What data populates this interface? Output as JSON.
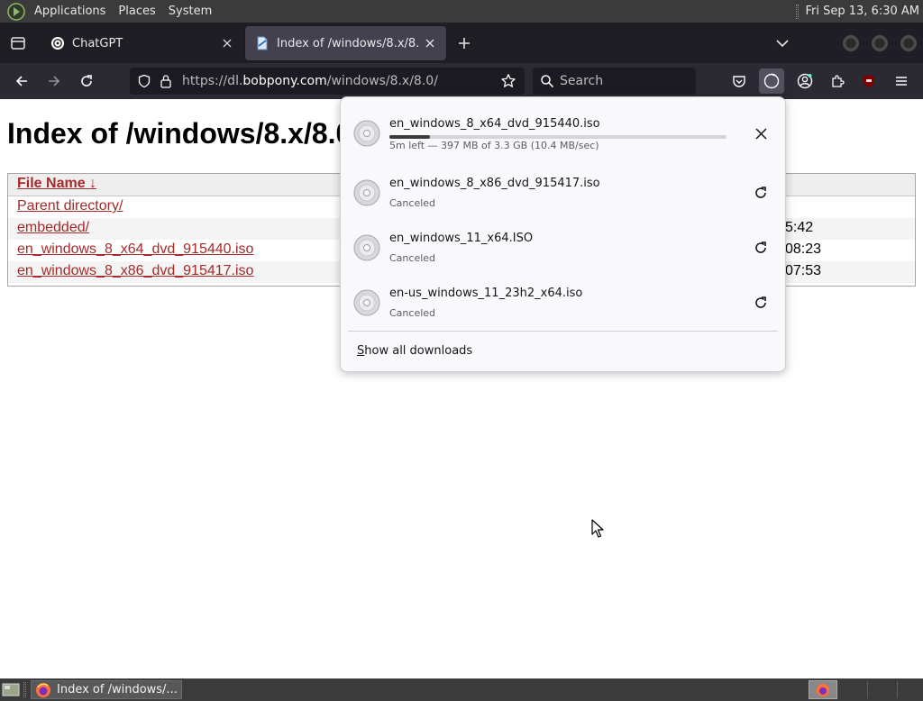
{
  "top_panel": {
    "menus": [
      "Applications",
      "Places",
      "System"
    ],
    "clock": "Fri Sep 13,  6:30 AM"
  },
  "browser": {
    "tabs": [
      {
        "title": "ChatGPT",
        "favicon": "chatgpt-favicon-icon",
        "active": false
      },
      {
        "title": "Index of /windows/8.x/8.0/",
        "favicon": "document-favicon-icon",
        "active": true
      }
    ],
    "url": {
      "prefix": "https://dl.",
      "host": "bobpony.com",
      "path": "/windows/8.x/8.0/"
    },
    "search_placeholder": "Search"
  },
  "page": {
    "title": "Index of /windows/8.x/8.0/",
    "column_filename": "File Name  ↓",
    "rows": [
      {
        "name": "Parent directory/",
        "date": ""
      },
      {
        "name": "embedded/",
        "date": "5:42"
      },
      {
        "name": "en_windows_8_x64_dvd_915440.iso",
        "date": "08:23"
      },
      {
        "name": "en_windows_8_x86_dvd_915417.iso",
        "date": "07:53"
      }
    ]
  },
  "downloads": {
    "items": [
      {
        "name": "en_windows_8_x64_dvd_915440.iso",
        "status": "5m left — 397 MB of 3.3 GB (10.4 MB/sec)",
        "progress": 0.12,
        "action": "close-icon"
      },
      {
        "name": "en_windows_8_x86_dvd_915417.iso",
        "status": "Canceled",
        "action": "retry-icon"
      },
      {
        "name": "en_windows_11_x64.ISO",
        "status": "Canceled",
        "action": "retry-icon"
      },
      {
        "name": "en-us_windows_11_23h2_x64.iso",
        "status": "Canceled",
        "action": "retry-icon"
      }
    ],
    "show_all_accel": "S",
    "show_all_rest": "how all downloads"
  },
  "taskbar": {
    "window_title": "Index of /windows/..."
  },
  "colors": {
    "panel_bg": "#3b3b3b",
    "tabstrip_bg": "#1f1e25",
    "navbar_bg": "#2b2a33",
    "link_color": "#a52a2a",
    "panel_popup_bg": "#f9f9fb"
  }
}
